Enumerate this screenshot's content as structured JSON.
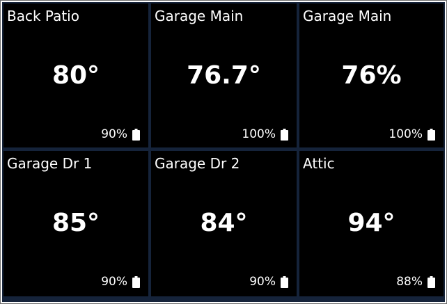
{
  "tiles": [
    {
      "name": "Back Patio",
      "value": "80°",
      "battery": "90%"
    },
    {
      "name": "Garage Main",
      "value": "76.7°",
      "battery": "100%"
    },
    {
      "name": "Garage Main",
      "value": "76%",
      "battery": "100%"
    },
    {
      "name": "Garage Dr 1",
      "value": "85°",
      "battery": "90%"
    },
    {
      "name": "Garage Dr 2",
      "value": "84°",
      "battery": "90%"
    },
    {
      "name": "Attic",
      "value": "94°",
      "battery": "88%"
    }
  ],
  "icons": {
    "battery": "battery-icon"
  },
  "colors": {
    "tile_background": "#000000",
    "gap_background": "#15233a",
    "text": "#ffffff"
  }
}
